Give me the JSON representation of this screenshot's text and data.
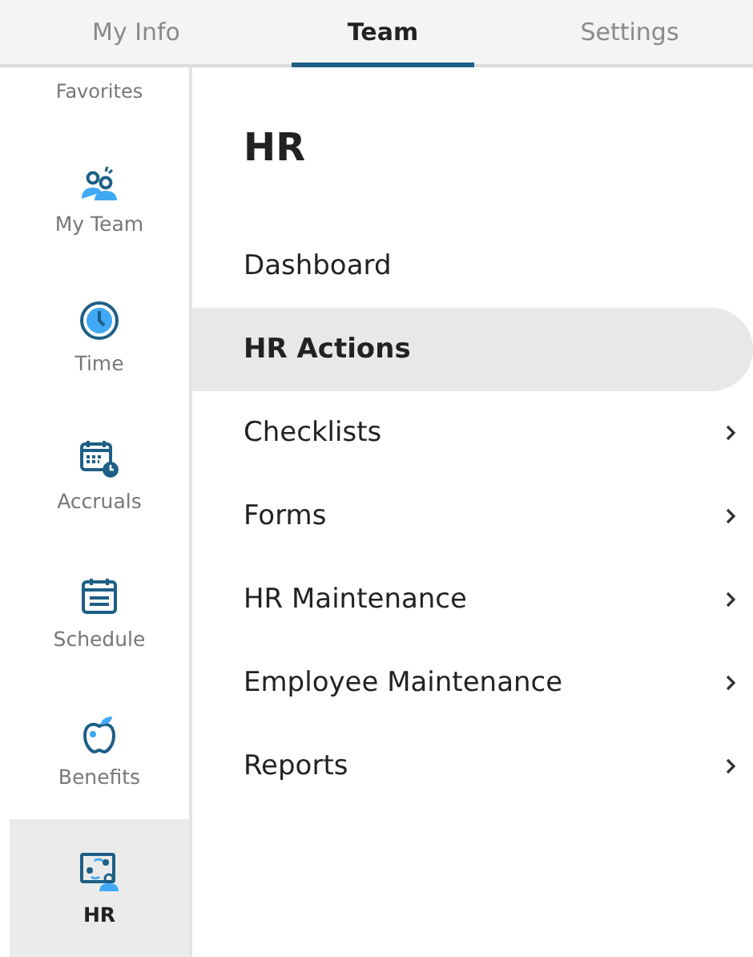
{
  "tabs": [
    {
      "label": "My Info",
      "selected": false
    },
    {
      "label": "Team",
      "selected": true
    },
    {
      "label": "Settings",
      "selected": false
    }
  ],
  "sidebar": {
    "heading": "Favorites",
    "items": [
      {
        "label": "My Team",
        "selected": false
      },
      {
        "label": "Time",
        "selected": false
      },
      {
        "label": "Accruals",
        "selected": false
      },
      {
        "label": "Schedule",
        "selected": false
      },
      {
        "label": "Benefits",
        "selected": false
      },
      {
        "label": "HR",
        "selected": true
      }
    ]
  },
  "main": {
    "title": "HR",
    "menu": [
      {
        "label": "Dashboard",
        "selected": false,
        "has_submenu": false
      },
      {
        "label": "HR Actions",
        "selected": true,
        "has_submenu": false
      },
      {
        "label": "Checklists",
        "selected": false,
        "has_submenu": true
      },
      {
        "label": "Forms",
        "selected": false,
        "has_submenu": true
      },
      {
        "label": "HR Maintenance",
        "selected": false,
        "has_submenu": true
      },
      {
        "label": "Employee Maintenance",
        "selected": false,
        "has_submenu": true
      },
      {
        "label": "Reports",
        "selected": false,
        "has_submenu": true
      }
    ]
  }
}
